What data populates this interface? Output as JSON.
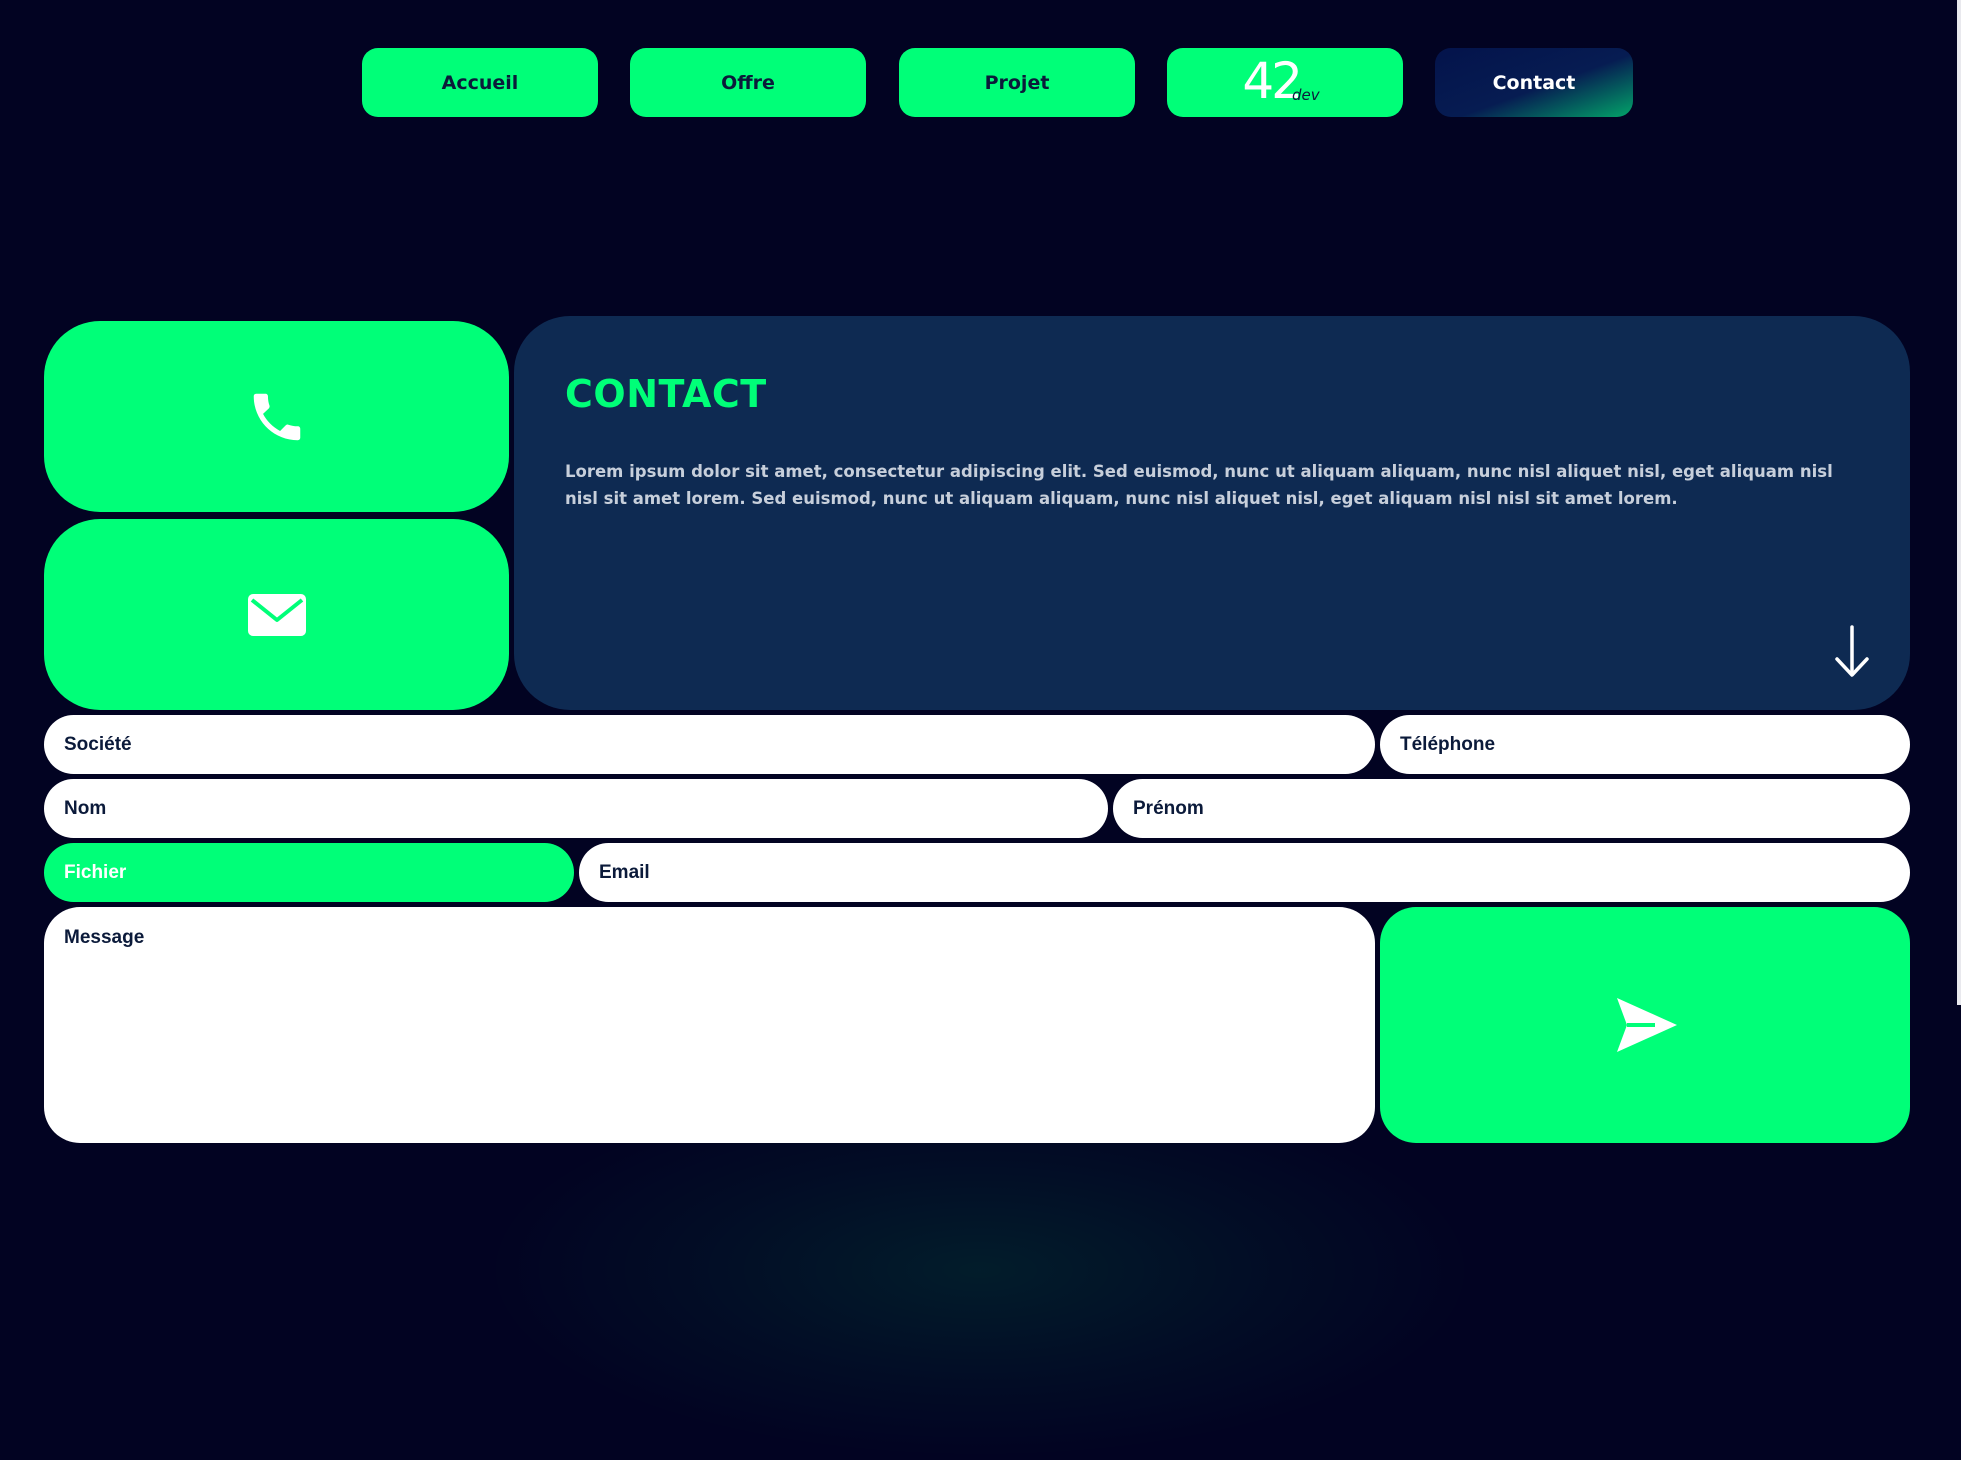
{
  "nav": {
    "home_label": "Accueil",
    "offer_label": "Offre",
    "project_label": "Projet",
    "logo_number": "42",
    "logo_suffix": "dev",
    "contact_label": "Contact"
  },
  "contact": {
    "title": "CONTACT",
    "description": "Lorem ipsum dolor sit amet, consectetur adipiscing elit. Sed euismod, nunc ut aliquam aliquam, nunc nisl aliquet nisl, eget aliquam nisl nisl sit amet lorem. Sed euismod, nunc ut aliquam aliquam, nunc nisl aliquet nisl, eget aliquam nisl nisl sit amet lorem.",
    "phone_icon": "phone-icon",
    "mail_icon": "mail-icon",
    "scroll_icon": "arrow-down-icon"
  },
  "form": {
    "societe": "Société",
    "telephone": "Téléphone",
    "nom": "Nom",
    "prenom": "Prénom",
    "fichier": "Fichier",
    "email": "Email",
    "message": "Message",
    "send_icon": "send-icon"
  },
  "colors": {
    "background": "#020322",
    "accent": "#00ff78",
    "panel": "#0e2a52",
    "text_dark": "#0b1a3a"
  }
}
